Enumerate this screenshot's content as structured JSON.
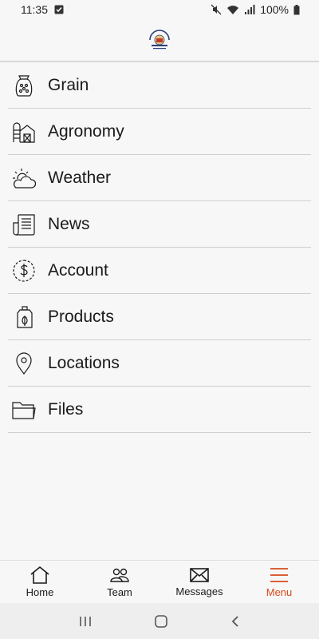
{
  "status_bar": {
    "time": "11:35",
    "battery": "100%"
  },
  "header": {
    "logo_icon": "full-circle-ag-logo"
  },
  "menu": {
    "items": [
      {
        "label": "Grain",
        "icon": "grain-sack-icon"
      },
      {
        "label": "Agronomy",
        "icon": "barn-silo-icon"
      },
      {
        "label": "Weather",
        "icon": "sun-cloud-icon"
      },
      {
        "label": "News",
        "icon": "newspaper-icon"
      },
      {
        "label": "Account",
        "icon": "dollar-circle-icon"
      },
      {
        "label": "Products",
        "icon": "jug-leaf-icon"
      },
      {
        "label": "Locations",
        "icon": "map-pin-icon"
      },
      {
        "label": "Files",
        "icon": "folder-icon"
      }
    ]
  },
  "bottom_nav": {
    "items": [
      {
        "label": "Home",
        "icon": "home-icon"
      },
      {
        "label": "Team",
        "icon": "team-icon"
      },
      {
        "label": "Messages",
        "icon": "envelope-icon"
      },
      {
        "label": "Menu",
        "icon": "hamburger-icon",
        "active": true
      }
    ]
  },
  "colors": {
    "accent": "#d64b1e",
    "background": "#f7f7f7",
    "divider": "#cfcfcf"
  }
}
